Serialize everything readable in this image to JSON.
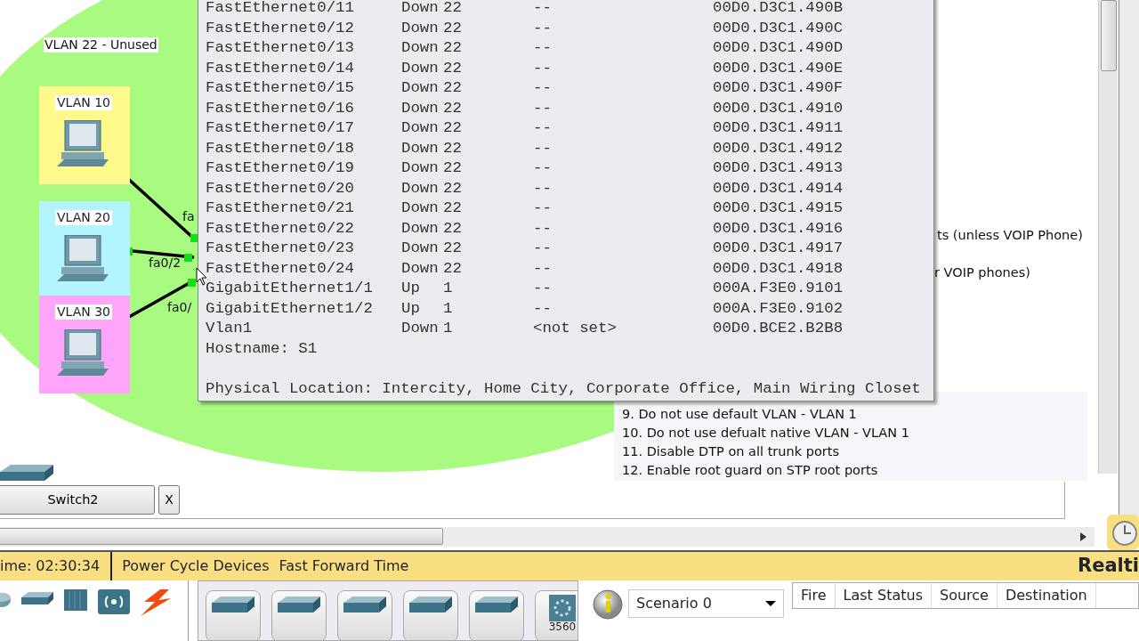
{
  "topology": {
    "zone_label": "VLAN 22 - Unused",
    "hosts": [
      {
        "label": "VLAN 10",
        "color": "#fff88a"
      },
      {
        "label": "VLAN 20",
        "color": "#b2f5ff"
      },
      {
        "label": "VLAN 30",
        "color": "#ffa6fa"
      }
    ],
    "port_labels": [
      "fa",
      "fa0/2",
      "fa0/"
    ]
  },
  "notes": [
    "ts (unless VOIP Phone)",
    "r VOIP phones)",
    "9. Do not use default VLAN - VLAN 1",
    "10. Do not use defualt native VLAN - VLAN 1",
    "11. Disable DTP on all trunk ports",
    "12. Enable root guard on STP root ports"
  ],
  "tooltip": {
    "rows": [
      [
        "FastEthernet0/11",
        "Down",
        "22",
        "--",
        "00D0.D3C1.490B"
      ],
      [
        "FastEthernet0/12",
        "Down",
        "22",
        "--",
        "00D0.D3C1.490C"
      ],
      [
        "FastEthernet0/13",
        "Down",
        "22",
        "--",
        "00D0.D3C1.490D"
      ],
      [
        "FastEthernet0/14",
        "Down",
        "22",
        "--",
        "00D0.D3C1.490E"
      ],
      [
        "FastEthernet0/15",
        "Down",
        "22",
        "--",
        "00D0.D3C1.490F"
      ],
      [
        "FastEthernet0/16",
        "Down",
        "22",
        "--",
        "00D0.D3C1.4910"
      ],
      [
        "FastEthernet0/17",
        "Down",
        "22",
        "--",
        "00D0.D3C1.4911"
      ],
      [
        "FastEthernet0/18",
        "Down",
        "22",
        "--",
        "00D0.D3C1.4912"
      ],
      [
        "FastEthernet0/19",
        "Down",
        "22",
        "--",
        "00D0.D3C1.4913"
      ],
      [
        "FastEthernet0/20",
        "Down",
        "22",
        "--",
        "00D0.D3C1.4914"
      ],
      [
        "FastEthernet0/21",
        "Down",
        "22",
        "--",
        "00D0.D3C1.4915"
      ],
      [
        "FastEthernet0/22",
        "Down",
        "22",
        "--",
        "00D0.D3C1.4916"
      ],
      [
        "FastEthernet0/23",
        "Down",
        "22",
        "--",
        "00D0.D3C1.4917"
      ],
      [
        "FastEthernet0/24",
        "Down",
        "22",
        "--",
        "00D0.D3C1.4918"
      ],
      [
        "GigabitEthernet1/1",
        "Up",
        "1",
        "--",
        "000A.F3E0.9101"
      ],
      [
        "GigabitEthernet1/2",
        "Up",
        "1",
        "--",
        "000A.F3E0.9102"
      ],
      [
        "Vlan1",
        "Down",
        "1",
        "<not set>",
        "00D0.BCE2.B2B8"
      ]
    ],
    "hostname": "Hostname: S1",
    "location": "Physical Location: Intercity, Home City, Corporate Office, Main Wiring Closet"
  },
  "device_tab": {
    "label": "Switch2",
    "close": "X"
  },
  "status_bar": {
    "time": "ime: 02:30:34",
    "actions": [
      "Power Cycle Devices",
      "Fast Forward Time"
    ],
    "mode": "Realti"
  },
  "devices": [
    {
      "kind": "switch"
    },
    {
      "kind": "switch"
    },
    {
      "kind": "switch"
    },
    {
      "kind": "switch"
    },
    {
      "kind": "switch"
    },
    {
      "kind": "multilayer",
      "label": "3560"
    }
  ],
  "scenario": {
    "value": "Scenario 0"
  },
  "pdu_table": {
    "columns": [
      "Fire",
      "Last Status",
      "Source",
      "Destination"
    ]
  }
}
